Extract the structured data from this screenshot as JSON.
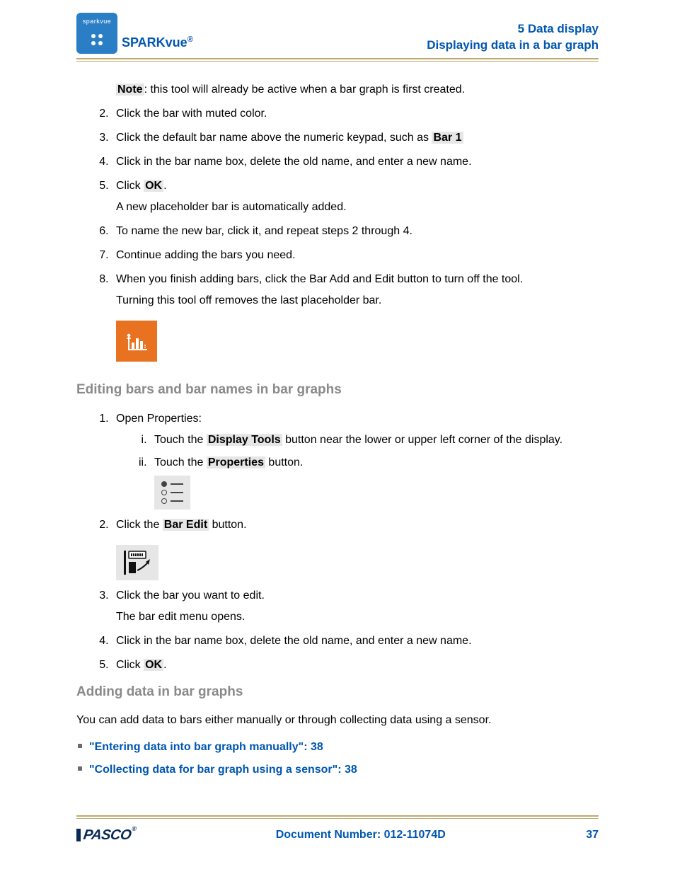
{
  "header": {
    "logo_text": "sparkvue",
    "product_name": "SPARKvue",
    "product_reg": "®",
    "chapter": "5   Data display",
    "section": "Displaying data in a bar graph"
  },
  "note": {
    "label": "Note",
    "text": ": this tool will already be active when a bar graph is first created."
  },
  "steps_a": {
    "s2": "Click the bar with muted color.",
    "s3_pre": "Click the default bar name above the numeric keypad, such as ",
    "s3_bold": "Bar 1",
    "s4": "Click in the bar name box, delete the old name, and enter a new name.",
    "s5_pre": "Click ",
    "s5_bold": "OK",
    "s5_post": ".",
    "s5_sub": "A new placeholder bar is automatically added.",
    "s6": "To name the new bar, click it, and repeat steps 2 through 4.",
    "s7": "Continue adding the bars you need.",
    "s8a": "When you finish adding bars, click the Bar Add and Edit button to turn off the tool.",
    "s8b": "Turning this tool off removes the last placeholder bar."
  },
  "section_edit": "Editing bars and bar names in bar graphs",
  "edit_steps": {
    "s1": "Open Properties:",
    "s1_i_pre": "Touch the ",
    "s1_i_bold": "Display Tools",
    "s1_i_post": " button near the lower or upper left corner of the display.",
    "s1_ii_pre": "Touch the ",
    "s1_ii_bold": "Properties",
    "s1_ii_post": " button.",
    "s2_pre": "Click the ",
    "s2_bold": "Bar Edit",
    "s2_post": " button.",
    "s3a": "Click the bar you want to edit.",
    "s3b": "The bar edit menu opens.",
    "s4": "Click in the bar name box, delete the old name, and enter a new name.",
    "s5_pre": "Click ",
    "s5_bold": "OK",
    "s5_post": "."
  },
  "section_add": "Adding data in bar graphs",
  "add_intro": "You can add data to bars either manually or through collecting data using a sensor.",
  "links": {
    "l1": "\"Entering data into bar graph manually\":  38",
    "l2": "\"Collecting data for bar graph using a sensor\":  38"
  },
  "footer": {
    "brand": "PASCO",
    "doc": "Document Number: 012-11074D",
    "page": "37"
  }
}
